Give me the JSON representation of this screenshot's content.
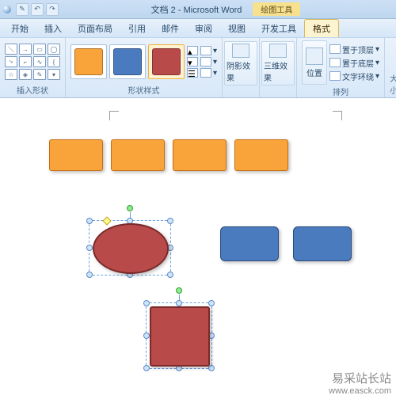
{
  "title": {
    "doc": "文档 2",
    "app": "Microsoft Word",
    "context": "绘图工具"
  },
  "tabs": {
    "items": [
      {
        "label": "开始"
      },
      {
        "label": "插入"
      },
      {
        "label": "页面布局"
      },
      {
        "label": "引用"
      },
      {
        "label": "邮件"
      },
      {
        "label": "审阅"
      },
      {
        "label": "视图"
      },
      {
        "label": "开发工具"
      },
      {
        "label": "格式"
      }
    ],
    "active_index": 8
  },
  "groups": {
    "insert_shape": "插入形状",
    "shape_styles": "形状样式",
    "shadow": "阴影效果",
    "threeD": "三维效果",
    "position": "位置",
    "arrange": "排列",
    "size": "大小",
    "arrange_items": {
      "front": "置于顶层",
      "back": "置于底层",
      "wrap": "文字环绕"
    }
  },
  "styles": {
    "c1": "#f9a43a",
    "c2": "#4a7bbf",
    "c3": "#b84a4a",
    "selected": 2
  },
  "chart_data": null,
  "watermark": {
    "line1": "易采站长站",
    "line2": "www.easck.com"
  }
}
